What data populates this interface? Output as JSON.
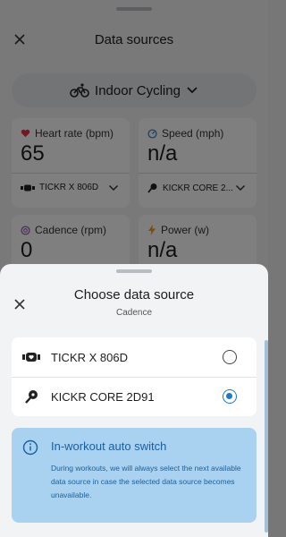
{
  "background": {
    "title": "Data sources",
    "activity": "Indoor Cycling",
    "cards": [
      {
        "metric": "Heart rate (bpm)",
        "value": "65",
        "source": "TICKR X 806D"
      },
      {
        "metric": "Speed (mph)",
        "value": "n/a",
        "source": "KICKR CORE 2..."
      },
      {
        "metric": "Cadence (rpm)",
        "value": "0"
      },
      {
        "metric": "Power (w)",
        "value": "n/a"
      }
    ]
  },
  "sheet": {
    "title": "Choose data source",
    "subtitle": "Cadence",
    "options": [
      {
        "label": "TICKR X 806D",
        "icon": "heart-strap-icon",
        "selected": false
      },
      {
        "label": "KICKR CORE 2D91",
        "icon": "trainer-icon",
        "selected": true
      }
    ],
    "info": {
      "title": "In-workout auto switch",
      "text": "During workouts, we will always select the next available data source in case the selected data source becomes unavailable."
    }
  },
  "colors": {
    "accent": "#1f79c7",
    "info_bg": "#a8d2ef",
    "heart": "#e0344b",
    "speed": "#3b82c4",
    "cadence": "#9b59b6",
    "power": "#f39c12"
  }
}
